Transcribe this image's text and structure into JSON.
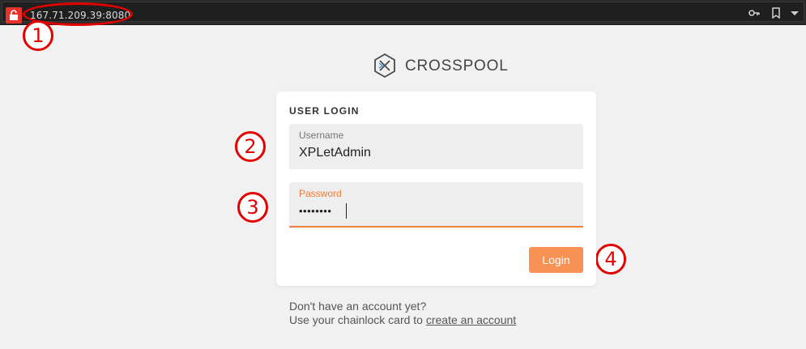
{
  "browser": {
    "url": "167.71.209.39:8080",
    "icons": [
      "lock-icon",
      "key-icon",
      "bookmark-icon",
      "menu-arrow-icon"
    ]
  },
  "annotations": [
    "1",
    "2",
    "3",
    "4"
  ],
  "brand": {
    "name": "CROSSPOOL",
    "logo": "crosspool-logo-icon"
  },
  "login": {
    "title": "USER LOGIN",
    "username_label": "Username",
    "username_value": "XPLetAdmin",
    "password_label": "Password",
    "password_value": "••••••••",
    "button": "Login"
  },
  "footer": {
    "line1": "Don't have an account yet?",
    "line2_prefix": "Use your chainlock card to ",
    "link": "create an account"
  },
  "colors": {
    "accent": "#f79154",
    "focus_underline": "#f0803c",
    "annotation": "#e30000",
    "lock_red": "#e8332a"
  }
}
